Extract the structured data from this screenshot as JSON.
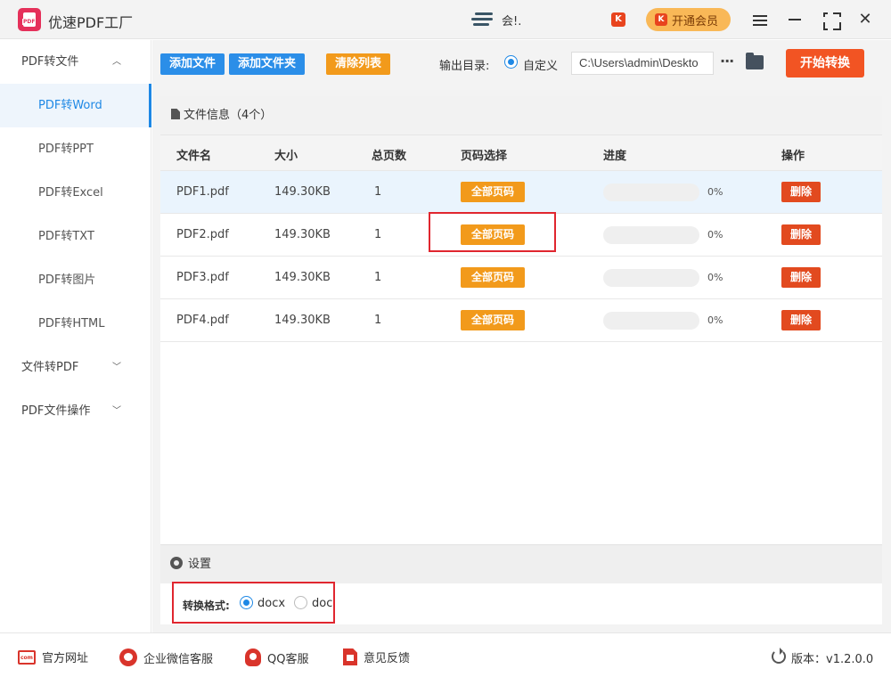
{
  "app": {
    "title": "优速PDF工厂",
    "user_name": "会!."
  },
  "header": {
    "vip_label": "开通会员",
    "kk_icon": "K"
  },
  "sidebar": {
    "groups": [
      {
        "label": "PDF转文件",
        "chevron": "^"
      },
      {
        "label": "文件转PDF",
        "chevron": "v"
      },
      {
        "label": "PDF文件操作",
        "chevron": "v"
      }
    ],
    "items": [
      "PDF转Word",
      "PDF转PPT",
      "PDF转Excel",
      "PDF转TXT",
      "PDF转图片",
      "PDF转HTML"
    ],
    "active_item": "PDF转Word"
  },
  "toolbar": {
    "add_file": "添加文件",
    "add_folder": "添加文件夹",
    "clear_list": "清除列表",
    "output_label": "输出目录:",
    "output_option": "自定义",
    "output_path": "C:\\Users\\admin\\Deskto",
    "more": "···",
    "start": "开始转换"
  },
  "file_panel": {
    "title": "文件信息（4个）",
    "columns": [
      "文件名",
      "大小",
      "总页数",
      "页码选择",
      "进度",
      "操作"
    ],
    "rows": [
      {
        "name": "PDF1.pdf",
        "size": "149.30KB",
        "pages": "1",
        "page_select": "全部页码",
        "progress_label": "0%",
        "progress": 0,
        "action": "删除"
      },
      {
        "name": "PDF2.pdf",
        "size": "149.30KB",
        "pages": "1",
        "page_select": "全部页码",
        "progress_label": "0%",
        "progress": 0,
        "action": "删除"
      },
      {
        "name": "PDF3.pdf",
        "size": "149.30KB",
        "pages": "1",
        "page_select": "全部页码",
        "progress_label": "0%",
        "progress": 0,
        "action": "删除"
      },
      {
        "name": "PDF4.pdf",
        "size": "149.30KB",
        "pages": "1",
        "page_select": "全部页码",
        "progress_label": "0%",
        "progress": 0,
        "action": "删除"
      }
    ]
  },
  "settings": {
    "title": "设置",
    "format_label": "转换格式:",
    "options": [
      "docx",
      "doc"
    ],
    "selected": "docx"
  },
  "footer": {
    "links": [
      "官方网址",
      "企业微信客服",
      "QQ客服",
      "意见反馈"
    ],
    "version": "版本：v1.2.0.0"
  },
  "colors": {
    "accent_blue": "#2b8ee8",
    "accent_orange": "#f29a1b",
    "danger_red": "#e24a1f",
    "start_red": "#f25423",
    "highlight_box": "#e0262f"
  }
}
